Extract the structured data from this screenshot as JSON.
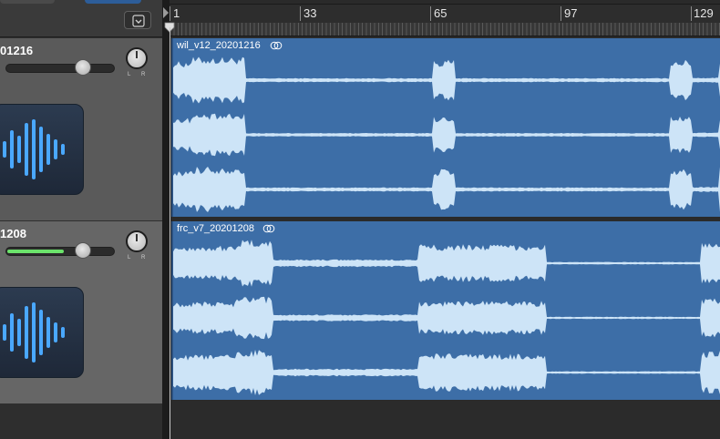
{
  "ruler": {
    "bars": [
      {
        "label": "1"
      },
      {
        "label": "33"
      },
      {
        "label": "65"
      },
      {
        "label": "97"
      },
      {
        "label": "129"
      }
    ]
  },
  "tracks": [
    {
      "name": "01216",
      "region_name": "wil_v12_20201216",
      "volume": 0.72,
      "meter_level": 0,
      "pan_labels": {
        "left": "L",
        "right": "R"
      },
      "icon": "waveform-icon"
    },
    {
      "name": "1208",
      "region_name": "frc_v7_20201208",
      "volume": 0.72,
      "meter_level": 0.6,
      "pan_labels": {
        "left": "L",
        "right": "R"
      },
      "icon": "waveform-icon"
    }
  ],
  "colors": {
    "region": "#3d6ea7",
    "waveform_fill": "#cde4f7",
    "meter": "#6be36b",
    "icon_accent": "#4aa8ff"
  }
}
